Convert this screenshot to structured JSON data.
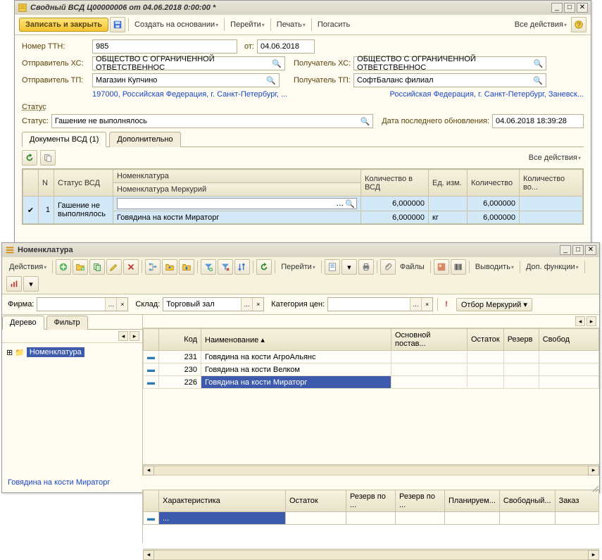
{
  "win1": {
    "title": "Сводный ВСД Ц00000006 от 04.06.2018 0:00:00 *",
    "toolbar": {
      "save_close": "Записать и закрыть",
      "create_based": "Создать на основании",
      "goto": "Перейти",
      "print": "Печать",
      "pogasit": "Погасить",
      "all_actions": "Все действия"
    },
    "form": {
      "ttn_label": "Номер ТТН:",
      "ttn_value": "985",
      "ot_label": "от:",
      "ot_value": "04.06.2018",
      "sender_hs_label": "Отправитель ХС:",
      "sender_hs_value": "ОБЩЕСТВО С ОГРАНИЧЕННОЙ ОТВЕТСТВЕННОС",
      "recipient_hs_label": "Получатель ХС:",
      "recipient_hs_value": "ОБЩЕСТВО С ОГРАНИЧЕННОЙ ОТВЕТСТВЕННОС",
      "sender_tp_label": "Отправитель ТП:",
      "sender_tp_value": "Магазин Купчино",
      "recipient_tp_label": "Получатель ТП:",
      "recipient_tp_value": "СофтБаланс филиал",
      "sender_addr": "197000, Российская Федерация, г. Санкт-Петербург, ...",
      "recipient_addr": "Российская Федерация, г. Санкт-Петербург, Заневск...",
      "status_section": "Статус",
      "status_label": "Статус:",
      "status_value": "Гашение не выполнялось",
      "updated_label": "Дата последнего обновления:",
      "updated_value": "04.06.2018 18:39:28"
    },
    "tabs": {
      "docs": "Документы ВСД (1)",
      "extra": "Дополнительно"
    },
    "sub_toolbar": {
      "all_actions": "Все действия"
    },
    "grid": {
      "headers": {
        "n": "N",
        "status": "Статус ВСД",
        "nomen": "Номенклатура",
        "nomen_mercury": "Номенклатура Меркурий",
        "qty_vsd": "Количество в ВСД",
        "unit": "Ед. изм.",
        "qty": "Количество",
        "qty_in": "Количество во..."
      },
      "row": {
        "n": "1",
        "status": "Гашение не выполнялось",
        "nomen": "",
        "nomen_mercury": "Говядина на кости Мираторг",
        "qty_vsd": "6,000000",
        "unit": "кг",
        "qty_vsd2": "6,000000",
        "qty_unit2": "",
        "qty": "6,000000",
        "qty2": "6,000000"
      }
    }
  },
  "win2": {
    "title": "Номенклатура",
    "toolbar": {
      "actions": "Действия",
      "goto": "Перейти",
      "files": "Файлы",
      "output": "Выводить",
      "extra_fn": "Доп. функции"
    },
    "filters": {
      "firma_label": "Фирма:",
      "firma_value": "",
      "sklad_label": "Склад:",
      "sklad_value": "Торговый зал",
      "price_label": "Категория цен:",
      "price_value": "",
      "mercury_filter": "Отбор Меркурий"
    },
    "tree_tabs": {
      "tree": "Дерево",
      "filter": "Фильтр"
    },
    "tree_root": "Номенклатура",
    "list": {
      "headers": {
        "code": "Код",
        "name": "Наименование",
        "supplier": "Основной постав...",
        "stock": "Остаток",
        "reserve": "Резерв",
        "free": "Свобод"
      },
      "rows": [
        {
          "code": "231",
          "name": "Говядина на кости АгроАльянс"
        },
        {
          "code": "230",
          "name": "Говядина на кости Велком"
        },
        {
          "code": "226",
          "name": "Говядина на кости Мираторг"
        }
      ]
    },
    "detail_title": "Говядина на кости Мираторг",
    "detail": {
      "headers": {
        "char": "Характеристика",
        "stock": "Остаток",
        "rez1": "Резерв по ...",
        "rez2": "Резерв по ...",
        "plan": "Планируем...",
        "free": "Свободный...",
        "order": "Заказ"
      },
      "row_char": "..."
    }
  }
}
